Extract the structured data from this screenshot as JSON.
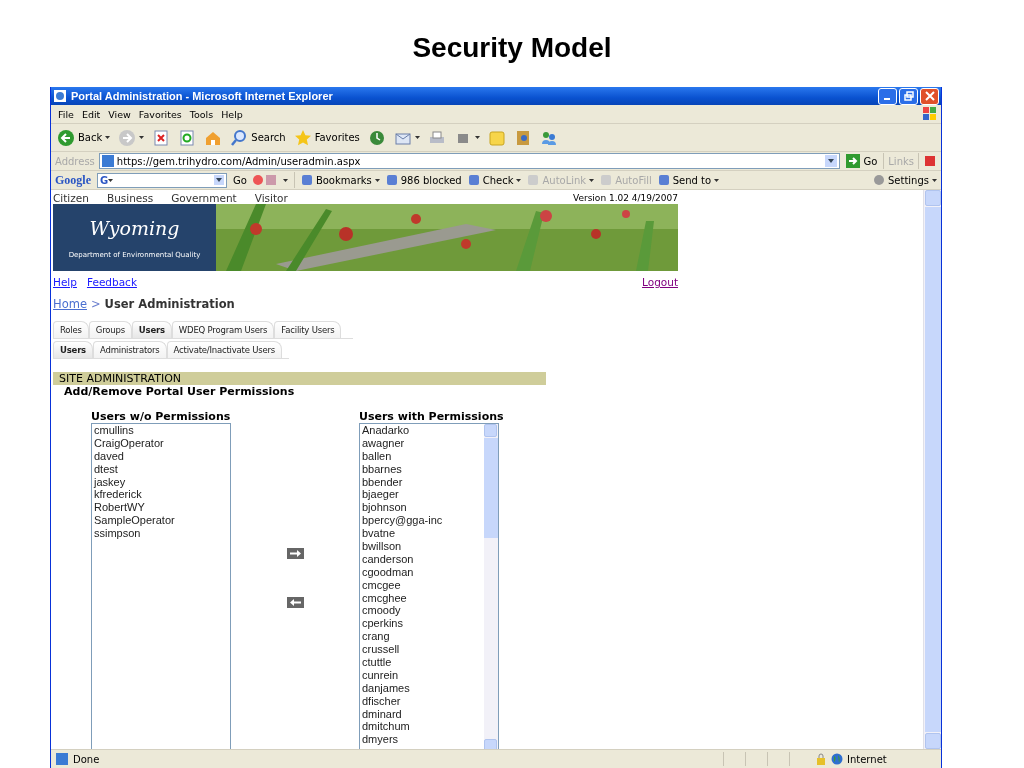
{
  "slide_title": "Security Model",
  "window": {
    "title": "Portal Administration - Microsoft Internet Explorer"
  },
  "menu": [
    "File",
    "Edit",
    "View",
    "Favorites",
    "Tools",
    "Help"
  ],
  "toolbar": [
    {
      "kind": "back",
      "label": "Back",
      "dropdown": true
    },
    {
      "kind": "forward",
      "dropdown": true
    },
    {
      "kind": "stop",
      "dropdown": false
    },
    {
      "kind": "refresh",
      "dropdown": false
    },
    {
      "kind": "home",
      "dropdown": false
    },
    {
      "kind": "search",
      "label": "Search",
      "dropdown": false
    },
    {
      "kind": "favorites",
      "label": "Favorites",
      "dropdown": false
    },
    {
      "kind": "history",
      "dropdown": false
    },
    {
      "kind": "mail",
      "dropdown": true
    },
    {
      "kind": "print",
      "dropdown": false
    },
    {
      "kind": "edit",
      "dropdown": true
    },
    {
      "kind": "notes",
      "dropdown": false
    },
    {
      "kind": "research",
      "dropdown": false
    },
    {
      "kind": "messenger",
      "dropdown": false
    }
  ],
  "address": {
    "label": "Address",
    "value": "https://gem.trihydro.com/Admin/useradmin.aspx",
    "go": "Go",
    "links": "Links"
  },
  "google_bar": {
    "brand": "Google",
    "search_letter": "G",
    "go": "Go",
    "items": [
      {
        "label": "Bookmarks",
        "disabled": false,
        "dropdown": true
      },
      {
        "label": "986 blocked",
        "disabled": false,
        "dropdown": false
      },
      {
        "label": "Check",
        "disabled": false,
        "dropdown": true
      },
      {
        "label": "AutoLink",
        "disabled": true,
        "dropdown": true
      },
      {
        "label": "AutoFill",
        "disabled": true,
        "dropdown": false
      },
      {
        "label": "Send to",
        "disabled": false,
        "dropdown": true
      }
    ],
    "settings": "Settings"
  },
  "page": {
    "top_nav": [
      "Citizen",
      "Business",
      "Government",
      "Visitor"
    ],
    "version": "Version 1.02 4/19/2007",
    "logo": {
      "name": "Wyoming",
      "department": "Department of Environmental Quality"
    },
    "links": [
      "Help",
      "Feedback"
    ],
    "logout": "Logout",
    "breadcrumb": {
      "home": "Home",
      "separator": ">",
      "current": "User Administration"
    },
    "tabs": [
      {
        "label": "Roles",
        "selected": false
      },
      {
        "label": "Groups",
        "selected": false
      },
      {
        "label": "Users",
        "selected": true
      },
      {
        "label": "WDEQ Program Users",
        "selected": false
      },
      {
        "label": "Facility Users",
        "selected": false
      }
    ],
    "subtabs": [
      {
        "label": "Users",
        "selected": true
      },
      {
        "label": "Administrators",
        "selected": false
      },
      {
        "label": "Activate/Inactivate Users",
        "selected": false
      }
    ],
    "section": "SITE ADMINISTRATION",
    "subtitle": "Add/Remove Portal User Permissions",
    "available": {
      "title": "Users w/o Permissions",
      "items": [
        "cmullins",
        "CraigOperator",
        "daved",
        "dtest",
        "jaskey",
        "kfrederick",
        "RobertWY",
        "SampleOperator",
        "ssimpson"
      ]
    },
    "assigned": {
      "title": "Users with Permissions",
      "items": [
        "Anadarko",
        "awagner",
        "ballen",
        "bbarnes",
        "bbender",
        "bjaeger",
        "bjohnson",
        "bpercy@gga-inc",
        "bvatne",
        "bwillson",
        "canderson",
        "cgoodman",
        "cmcgee",
        "cmcghee",
        "cmoody",
        "cperkins",
        "crang",
        "crussell",
        "ctuttle",
        "cunrein",
        "danjames",
        "dfischer",
        "dminard",
        "dmitchum",
        "dmyers"
      ]
    }
  },
  "status_bar": {
    "text": "Done",
    "zone": "Internet"
  }
}
